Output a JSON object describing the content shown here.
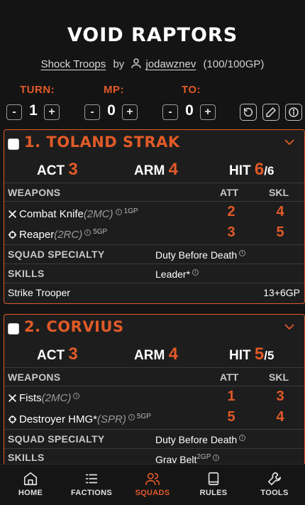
{
  "header": {
    "squad_name": "VOID RAPTORS",
    "faction": "Shock Troops",
    "by": "by",
    "user": "jodawznev",
    "gp": "(100/100GP)"
  },
  "counters": {
    "turn_label": "TURN:",
    "turn_value": "1",
    "mp_label": "MP:",
    "mp_value": "0",
    "to_label": "TO:",
    "to_value": "0",
    "minus": "-",
    "plus": "+"
  },
  "operatives": [
    {
      "name": "1. TOLAND STRAK",
      "act_label": "ACT",
      "act": "3",
      "arm_label": "ARM",
      "arm": "4",
      "hit_label": "HIT",
      "hit": "6",
      "hit_max": "/6",
      "weapons_header": "WEAPONS",
      "atk_header": "ATT",
      "skl_header": "SKL",
      "weapons": [
        {
          "icon": "crossed-swords-icon",
          "name": "Combat Knife",
          "type": "(2MC)",
          "cost": "1GP",
          "atk": "2",
          "skl": "4"
        },
        {
          "icon": "crosshair-icon",
          "name": "Reaper",
          "type": "(2RC)",
          "cost": "5GP",
          "atk": "3",
          "skl": "5"
        }
      ],
      "specialty_label": "SQUAD SPECIALTY",
      "specialty": "Duty Before Death",
      "skills_label": "SKILLS",
      "skills": "Leader*",
      "skills_cost": "",
      "class": "Strike Trooper",
      "cost": "13+6GP"
    },
    {
      "name": "2. CORVIUS",
      "act_label": "ACT",
      "act": "3",
      "arm_label": "ARM",
      "arm": "4",
      "hit_label": "HIT",
      "hit": "5",
      "hit_max": "/5",
      "weapons_header": "WEAPONS",
      "atk_header": "ATT",
      "skl_header": "SKL",
      "weapons": [
        {
          "icon": "crossed-swords-icon",
          "name": "Fists",
          "type": "(2MC)",
          "cost": "",
          "atk": "1",
          "skl": "3"
        },
        {
          "icon": "crosshair-icon",
          "name": "Destroyer HMG*",
          "type": "(SPR)",
          "cost": "5GP",
          "atk": "5",
          "skl": "4"
        }
      ],
      "specialty_label": "SQUAD SPECIALTY",
      "specialty": "Duty Before Death",
      "skills_label": "SKILLS",
      "skills": "Grav Belt",
      "skills_cost": "2GP"
    }
  ],
  "nav": [
    {
      "label": "HOME",
      "icon": "home-icon"
    },
    {
      "label": "FACTIONS",
      "icon": "list-icon"
    },
    {
      "label": "SQUADS",
      "icon": "users-icon",
      "active": true
    },
    {
      "label": "RULES",
      "icon": "book-icon"
    },
    {
      "label": "TOOLS",
      "icon": "wrench-icon"
    }
  ],
  "colors": {
    "accent": "#e05a28",
    "background": "#141414",
    "card": "#1d1d1d"
  }
}
